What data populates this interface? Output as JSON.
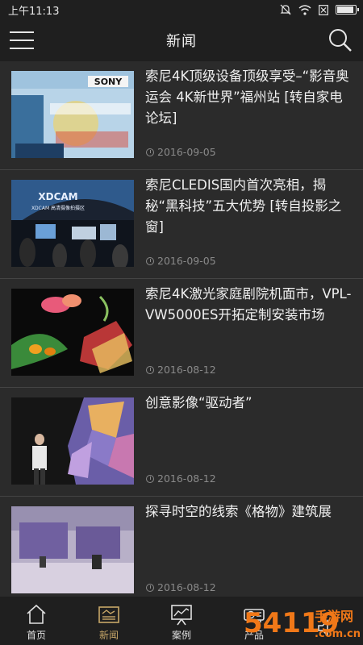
{
  "status_bar": {
    "time": "上午11:13"
  },
  "header": {
    "title": "新闻"
  },
  "news": [
    {
      "title": "索尼4K顶级设备顶级享受–“影音奥运会 4K新世界”福州站 [转自家电论坛]",
      "date": "2016-09-05"
    },
    {
      "title": "索尼CLEDIS国内首次亮相，揭秘“黑科技”五大优势 [转自投影之窗]",
      "date": "2016-09-05"
    },
    {
      "title": "索尼4K激光家庭剧院机面市，VPL-VW5000ES开拓定制安装市场",
      "date": "2016-08-12"
    },
    {
      "title": "创意影像“驱动者”",
      "date": "2016-08-12"
    },
    {
      "title": "探寻时空的线索《格物》建筑展",
      "date": "2016-08-12"
    }
  ],
  "thumbs": {
    "t1_logo": "SONY",
    "t2_logo": "XDCAM",
    "t2_sub": "XDCAM 高清摄像拍摄区"
  },
  "bottom_nav": [
    {
      "label": "首页"
    },
    {
      "label": "新闻"
    },
    {
      "label": "案例"
    },
    {
      "label": "产品"
    },
    {
      "label": ""
    }
  ],
  "watermark": {
    "brand": "54119",
    "text": "手游网",
    "domain": ".com.cn"
  },
  "colors": {
    "bg": "#2b2b2b",
    "bar": "#1f1f1f",
    "active": "#c8a768"
  }
}
